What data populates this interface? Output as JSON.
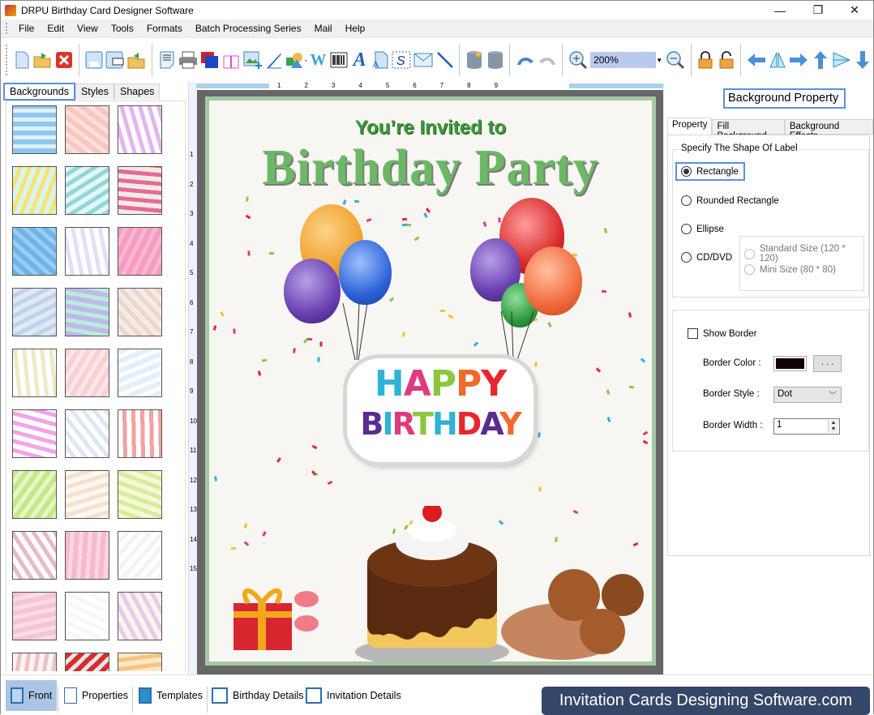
{
  "window": {
    "title": "DRPU Birthday Card Designer Software",
    "controls": {
      "minimize": "—",
      "maximize": "❐",
      "close": "✕"
    }
  },
  "menu": [
    "File",
    "Edit",
    "View",
    "Tools",
    "Formats",
    "Batch Processing Series",
    "Mail",
    "Help"
  ],
  "toolbar": {
    "groups": [
      [
        "new-icon",
        "open-icon",
        "close-icon"
      ],
      [
        "save-icon",
        "save-as-icon",
        "export-icon"
      ],
      [
        "properties-icon",
        "print-icon",
        "copy-design-icon",
        "gift-icon",
        "image-icon",
        "pen-icon",
        "shapes-icon",
        "watermark-icon",
        "barcode-icon",
        "text-icon",
        "wordart-icon",
        "signature-icon",
        "email-icon",
        "line-icon"
      ],
      [
        "database-add-icon",
        "database-icon"
      ],
      [
        "undo-icon",
        "redo-icon"
      ],
      [
        "zoom-in-icon",
        "zoom-combo",
        "zoom-out-icon"
      ],
      [
        "lock-icon",
        "unlock-icon"
      ],
      [
        "align-left-icon",
        "flip-icon",
        "align-right-icon",
        "align-top-icon",
        "align-middle-icon",
        "align-bottom-icon"
      ]
    ],
    "zoom_value": "200%"
  },
  "left_panel": {
    "tabs": [
      "Backgrounds",
      "Styles",
      "Shapes"
    ],
    "active_tab": "Backgrounds",
    "thumbnails": [
      {
        "name": "clouds",
        "c1": "#8fc7ef",
        "c2": "#dff0fb"
      },
      {
        "name": "pink-hearts",
        "c1": "#f7c7c0",
        "c2": "#fbe0dc"
      },
      {
        "name": "butterflies",
        "c1": "#ffffff",
        "c2": "#e6b3f2"
      },
      {
        "name": "flowers",
        "c1": "#d7f5ee",
        "c2": "#f8e273"
      },
      {
        "name": "cartoon",
        "c1": "#e6f4fb",
        "c2": "#8fd9d4"
      },
      {
        "name": "bird-balloons",
        "c1": "#f1ece1",
        "c2": "#e4699c"
      },
      {
        "name": "stars",
        "c1": "#6cb4ea",
        "c2": "#9cccf2"
      },
      {
        "name": "balloons-light",
        "c1": "#ffffff",
        "c2": "#e2e0f6"
      },
      {
        "name": "pink-cakes",
        "c1": "#f79ac0",
        "c2": "#f6b8d1"
      },
      {
        "name": "bubbles",
        "c1": "#dfe9f5",
        "c2": "#c0d2ea"
      },
      {
        "name": "rainbow",
        "c1": "#c2b7ef",
        "c2": "#b5f1d5"
      },
      {
        "name": "beige-floral",
        "c1": "#f5ebe5",
        "c2": "#ead6cf"
      },
      {
        "name": "happy-birthday-text",
        "c1": "#ffffff",
        "c2": "#eeeac6"
      },
      {
        "name": "pink-stripes",
        "c1": "#f9d0d3",
        "c2": "#fbe6e8"
      },
      {
        "name": "colorful-balloons",
        "c1": "#e1f0fb",
        "c2": "#ffffff"
      },
      {
        "name": "heart-outlines",
        "c1": "#ffffff",
        "c2": "#f2a4ea"
      },
      {
        "name": "balloon-bunches",
        "c1": "#ffffff",
        "c2": "#dfe6f6"
      },
      {
        "name": "red-hearts",
        "c1": "#ffffff",
        "c2": "#f2a2a2"
      },
      {
        "name": "green-stripes",
        "c1": "#c4ea88",
        "c2": "#e7f7c8"
      },
      {
        "name": "cake-pattern",
        "c1": "#fdf9e4",
        "c2": "#f5dede"
      },
      {
        "name": "dots-garden",
        "c1": "#f4f9d6",
        "c2": "#d8ec9c"
      },
      {
        "name": "roses",
        "c1": "#ffffff",
        "c2": "#e8b9c8"
      },
      {
        "name": "pink-lace",
        "c1": "#f8b8cd",
        "c2": "#fbd6e2"
      },
      {
        "name": "gifts",
        "c1": "#ffffff",
        "c2": "#f3f3f7"
      },
      {
        "name": "pink-texture",
        "c1": "#f7c4d5",
        "c2": "#fadce6"
      },
      {
        "name": "confetti",
        "c1": "#ffffff",
        "c2": "#f7f7f7"
      },
      {
        "name": "purple-flowers",
        "c1": "#fbf4ec",
        "c2": "#e7cbe8"
      },
      {
        "name": "cupcakes",
        "c1": "#fbf4f1",
        "c2": "#efc2c7"
      },
      {
        "name": "red-silver-hearts",
        "c1": "#d72d2d",
        "c2": "#e6e6e6"
      },
      {
        "name": "birthday-banner",
        "c1": "#fbe8c2",
        "c2": "#f5c384"
      }
    ]
  },
  "ruler": {
    "horizontal": [
      "1",
      "2",
      "3",
      "4",
      "5",
      "6",
      "7",
      "8",
      "9"
    ],
    "vertical": [
      "1",
      "2",
      "3",
      "4",
      "5",
      "6",
      "7",
      "8",
      "9",
      "10",
      "11",
      "12",
      "13",
      "14",
      "15"
    ]
  },
  "card": {
    "line1": "You’re Invited to",
    "line2": "Birthday Party",
    "sign_line1": [
      "H",
      "A",
      "P",
      "P",
      "Y"
    ],
    "sign_line2": [
      "B",
      "I",
      "R",
      "T",
      "H",
      "D",
      "A",
      "Y"
    ],
    "sign_colors1": [
      "#2fb2d6",
      "#e03a7d",
      "#8cc63f",
      "#f26a2a",
      "#e8262d"
    ],
    "sign_colors2": [
      "#5b2c8f",
      "#2fb2d6",
      "#e03a7d",
      "#8cc63f",
      "#2fb2d6",
      "#e8262d",
      "#5b2c8f",
      "#f26a2a"
    ],
    "title_color": "#3c9a3a",
    "frame_color": "#a4c8a2"
  },
  "right_panel": {
    "title": "Background Property",
    "tabs": [
      "Property",
      "Fill Background",
      "Background Effects"
    ],
    "active_tab": "Property",
    "shape_group_label": "Specify The Shape Of Label",
    "shapes": [
      {
        "label": "Rectangle",
        "selected": true
      },
      {
        "label": "Rounded Rectangle",
        "selected": false
      },
      {
        "label": "Ellipse",
        "selected": false
      },
      {
        "label": "CD/DVD",
        "selected": false
      }
    ],
    "cd_sizes": [
      {
        "label": "Standard Size (120 * 120)",
        "enabled": false
      },
      {
        "label": "Mini Size (80 * 80)",
        "enabled": false
      }
    ],
    "show_border_label": "Show Border",
    "show_border_checked": false,
    "border_color_label": "Border Color :",
    "border_color_value": "#130006",
    "browse_label": ". . .",
    "border_style_label": "Border Style :",
    "border_style_value": "Dot",
    "border_width_label": "Border Width :",
    "border_width_value": "1"
  },
  "bottom_tabs": [
    {
      "label": "Front",
      "active": true
    },
    {
      "label": "Properties",
      "active": false
    },
    {
      "label": "Templates",
      "active": false
    },
    {
      "label": "Birthday Details",
      "active": false
    },
    {
      "label": "Invitation Details",
      "active": false
    }
  ],
  "banner": "Invitation Cards Designing Software.com"
}
